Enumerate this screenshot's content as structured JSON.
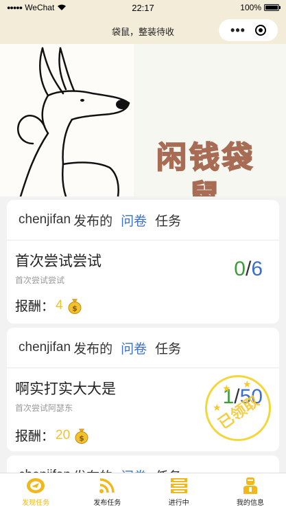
{
  "status_bar": {
    "carrier": "WeChat",
    "time": "22:17",
    "battery": "100%"
  },
  "nav": {
    "title": "袋鼠，整装待收"
  },
  "banner": {
    "line1": "闲钱袋鼠",
    "line2": "公告",
    "slide_count": 3,
    "active_slide": 0
  },
  "cards": [
    {
      "publisher": "chenjifan",
      "published_by": "发布的",
      "kind": "问卷",
      "task_word": "任务",
      "title": "首次尝试尝试",
      "desc": "首次尝试尝试",
      "reward_label": "报酬：",
      "reward": "4",
      "progress_done": "0",
      "progress_total": "6"
    },
    {
      "publisher": "chenjifan",
      "published_by": "发布的",
      "kind": "问卷",
      "task_word": "任务",
      "title": "啊实打实大大是",
      "desc": "首次尝试阿瑟东",
      "reward_label": "报酬：",
      "reward": "20",
      "progress_done": "1",
      "progress_total": "50",
      "stamp": "已领取"
    },
    {
      "publisher": "chenjifan",
      "published_by": "发布的",
      "kind": "问卷",
      "task_word": "任务"
    }
  ],
  "tabs": [
    {
      "label": "发现任务",
      "icon": "discover-icon",
      "active": true
    },
    {
      "label": "发布任务",
      "icon": "rss-icon",
      "active": false
    },
    {
      "label": "进行中",
      "icon": "list-icon",
      "active": false
    },
    {
      "label": "我的信息",
      "icon": "user-icon",
      "active": false
    }
  ],
  "colors": {
    "accent": "#f2b81b",
    "kind": "#3b6fc7",
    "done": "#3a9d3a",
    "header_bg": "#f3ecd9"
  }
}
